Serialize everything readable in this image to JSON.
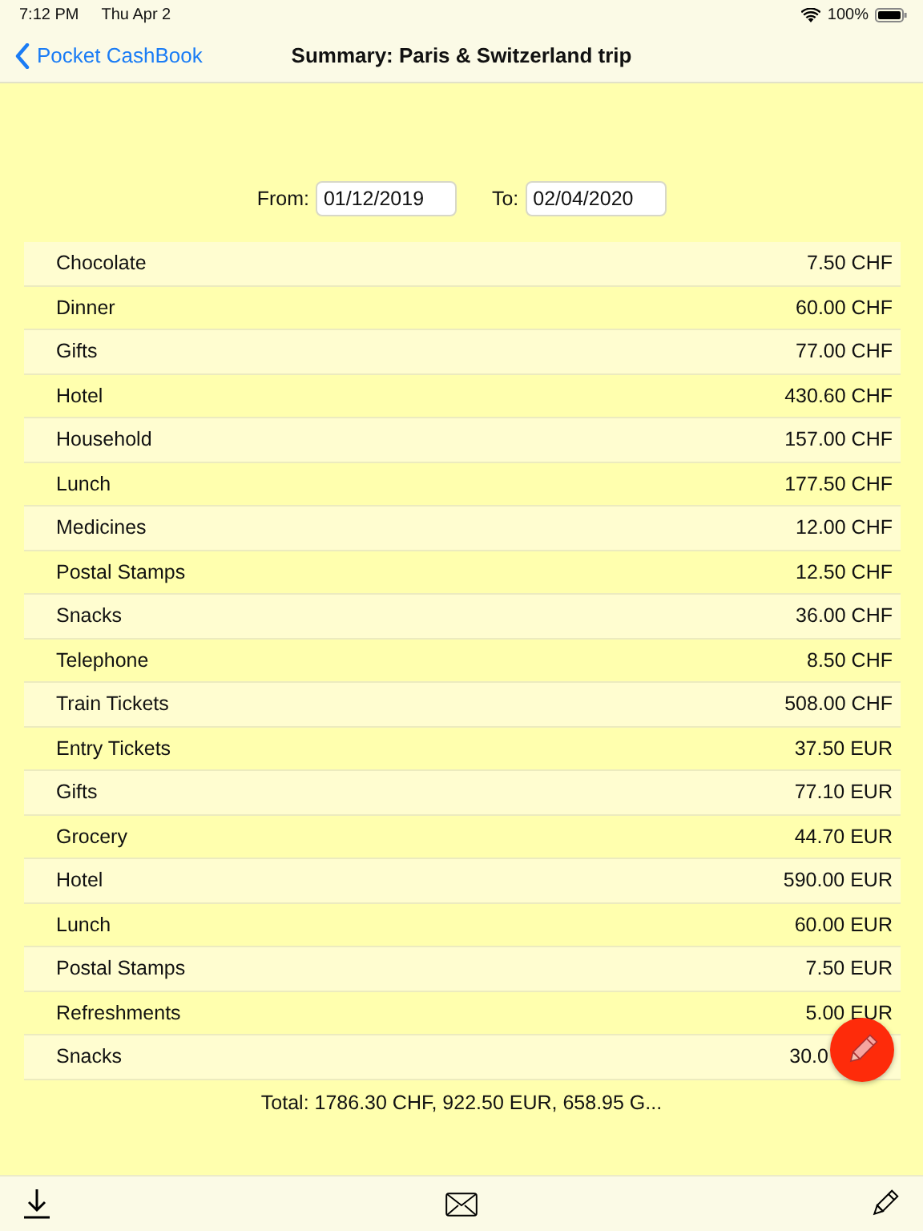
{
  "status_bar": {
    "time": "7:12 PM",
    "date": "Thu Apr 2",
    "battery": "100%"
  },
  "nav": {
    "back": "Pocket CashBook",
    "title": "Summary: Paris & Switzerland trip"
  },
  "filter": {
    "from_label": "From:",
    "from": "01/12/2019",
    "to_label": "To:",
    "to": "02/04/2020"
  },
  "rows": [
    {
      "category": "Chocolate",
      "amount": "7.50 CHF"
    },
    {
      "category": "Dinner",
      "amount": "60.00 CHF"
    },
    {
      "category": "Gifts",
      "amount": "77.00 CHF"
    },
    {
      "category": "Hotel",
      "amount": "430.60 CHF"
    },
    {
      "category": "Household",
      "amount": "157.00 CHF"
    },
    {
      "category": "Lunch",
      "amount": "177.50 CHF"
    },
    {
      "category": "Medicines",
      "amount": "12.00 CHF"
    },
    {
      "category": "Postal Stamps",
      "amount": "12.50 CHF"
    },
    {
      "category": "Snacks",
      "amount": "36.00 CHF"
    },
    {
      "category": "Telephone",
      "amount": "8.50 CHF"
    },
    {
      "category": "Train Tickets",
      "amount": "508.00 CHF"
    },
    {
      "category": "Entry Tickets",
      "amount": "37.50 EUR"
    },
    {
      "category": "Gifts",
      "amount": "77.10 EUR"
    },
    {
      "category": "Grocery",
      "amount": "44.70 EUR"
    },
    {
      "category": "Hotel",
      "amount": "590.00 EUR"
    },
    {
      "category": "Lunch",
      "amount": "60.00 EUR"
    },
    {
      "category": "Postal Stamps",
      "amount": "7.50 EUR"
    },
    {
      "category": "Refreshments",
      "amount": "5.00 EUR"
    },
    {
      "category": "Snacks",
      "amount": "30.0"
    }
  ],
  "total": "Total: 1786.30 CHF, 922.50 EUR, 658.95 G..."
}
